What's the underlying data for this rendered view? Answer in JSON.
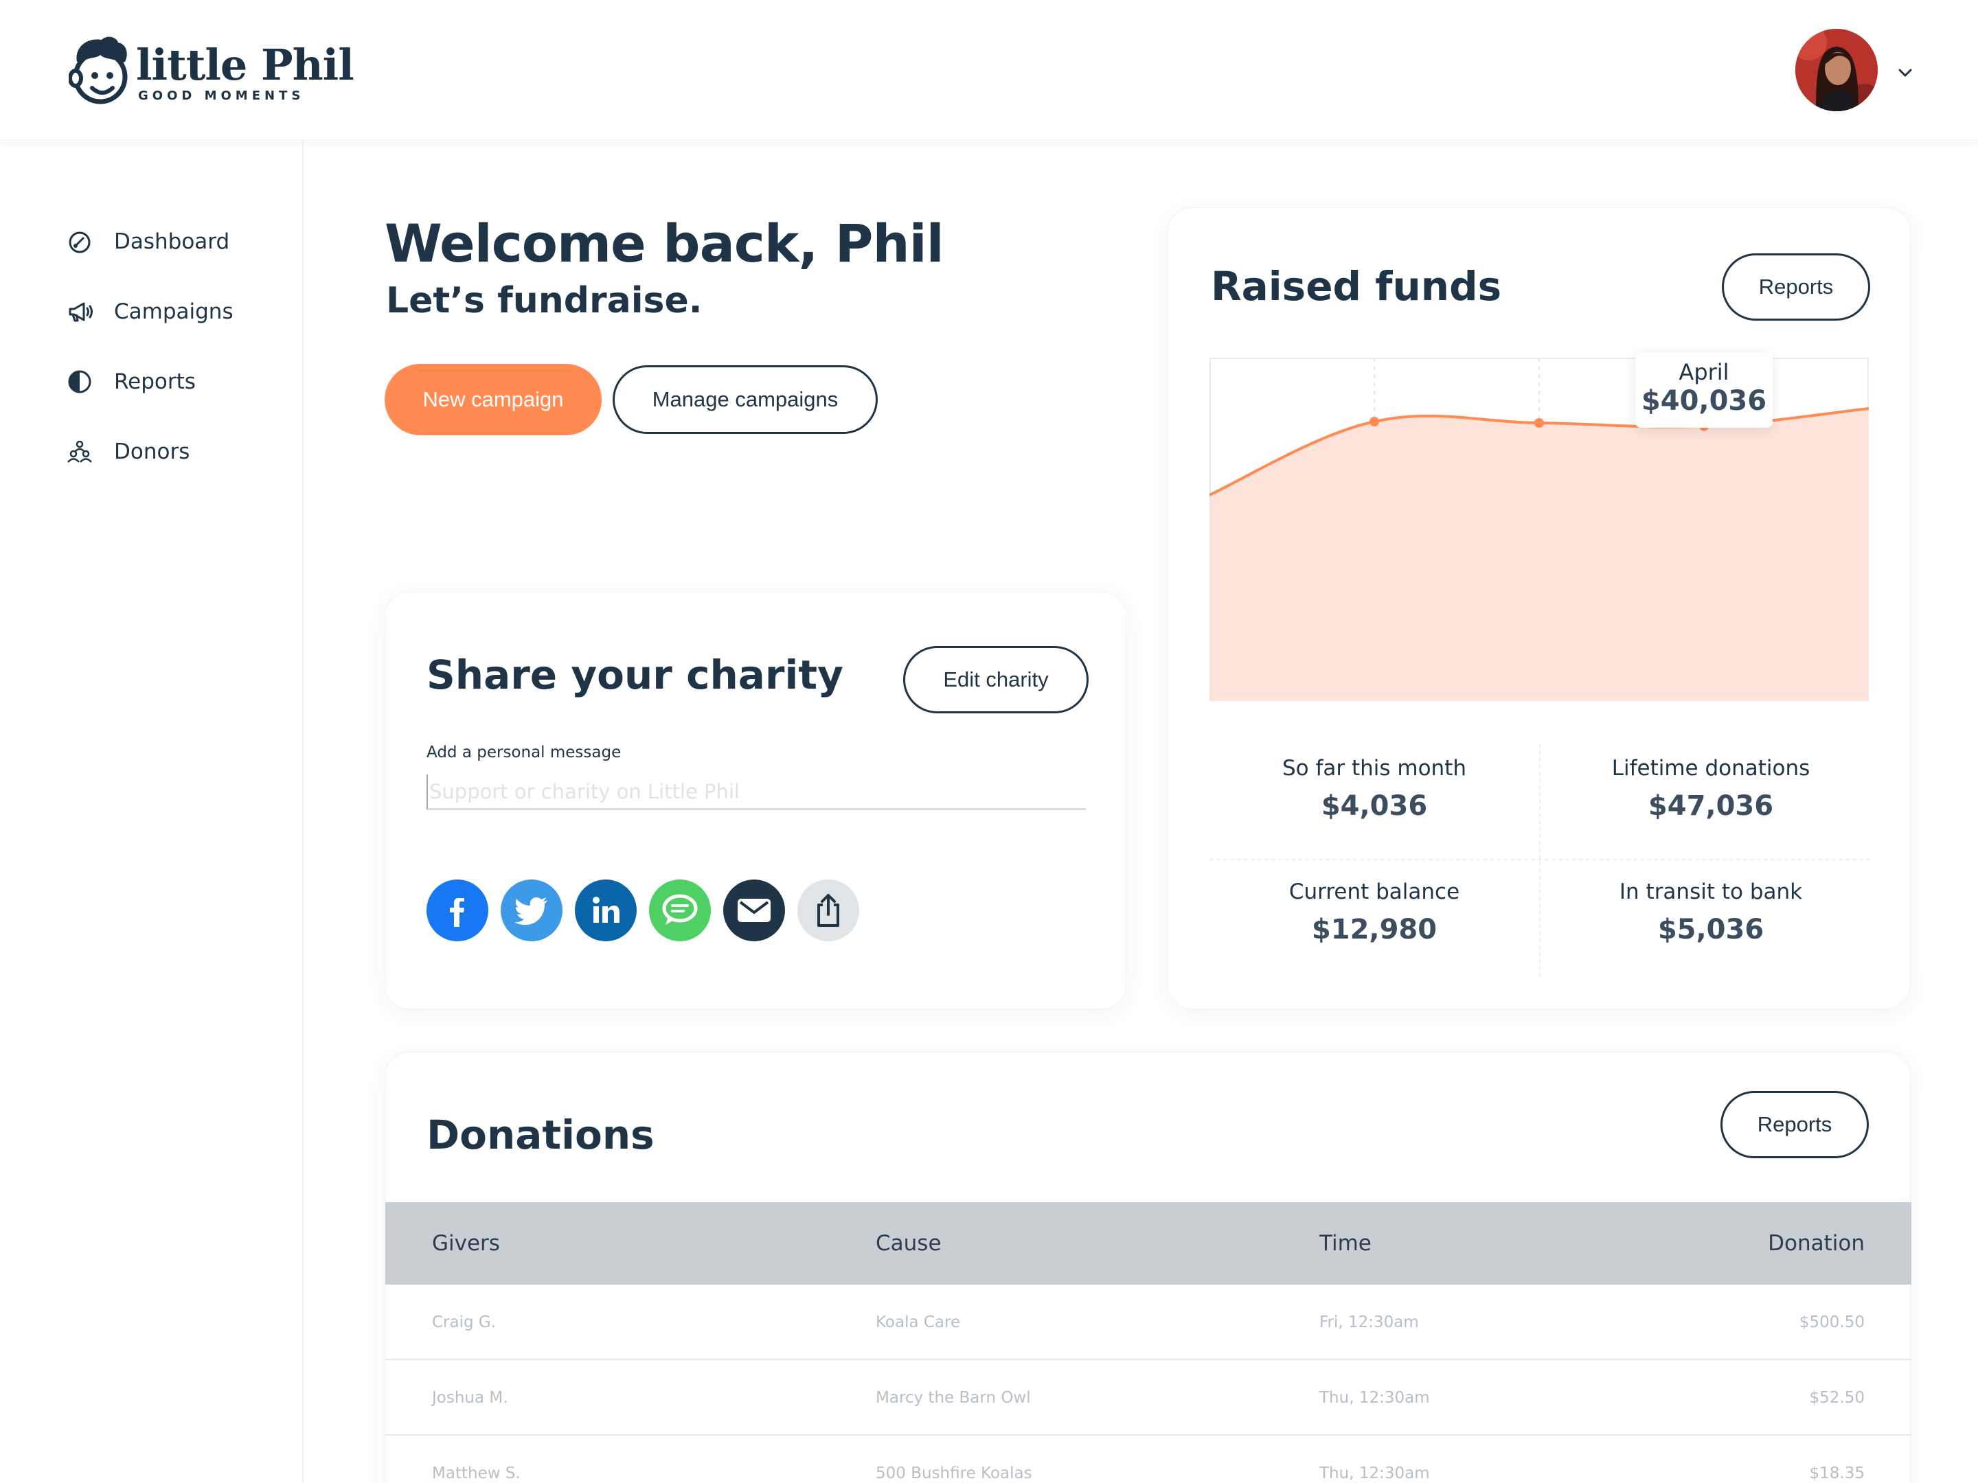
{
  "brand": {
    "name": "little Phil",
    "tagline": "GOOD MOMENTS"
  },
  "colors": {
    "accent": "#ff8a52",
    "navy": "#1f3447",
    "chart_fill": "#fde3d9",
    "table_header": "#c9ced3"
  },
  "sidebar": {
    "items": [
      {
        "label": "Dashboard",
        "icon": "gauge-icon"
      },
      {
        "label": "Campaigns",
        "icon": "megaphone-icon"
      },
      {
        "label": "Reports",
        "icon": "pie-chart-icon"
      },
      {
        "label": "Donors",
        "icon": "people-icon"
      }
    ]
  },
  "welcome": {
    "title": "Welcome back, Phil",
    "subtitle": "Let’s fundraise.",
    "new_campaign_label": "New campaign",
    "manage_campaigns_label": "Manage campaigns"
  },
  "share": {
    "title": "Share your charity",
    "edit_label": "Edit charity",
    "message_label": "Add a personal message",
    "message_placeholder": "Support or charity on Little Phil",
    "message_value": "",
    "networks": [
      "facebook-icon",
      "twitter-icon",
      "linkedin-icon",
      "message-icon",
      "email-icon",
      "share-icon"
    ]
  },
  "funds": {
    "title": "Raised funds",
    "reports_label": "Reports",
    "tooltip": {
      "month": "April",
      "value": "$40,036"
    },
    "stats": [
      {
        "label": "So far this month",
        "value": "$4,036"
      },
      {
        "label": "Lifetime donations",
        "value": "$47,036"
      },
      {
        "label": "Current balance",
        "value": "$12,980"
      },
      {
        "label": "In transit to bank",
        "value": "$5,036"
      }
    ]
  },
  "chart_data": {
    "type": "area",
    "points": [
      {
        "value": 30000
      },
      {
        "value": 40700
      },
      {
        "value": 40500
      },
      {
        "value": 40036
      },
      {
        "value": 42600
      }
    ],
    "highlighted_index": 3,
    "ylim": [
      0,
      50000
    ],
    "grid": true,
    "legend": "none"
  },
  "donations": {
    "title": "Donations",
    "reports_label": "Reports",
    "columns": [
      "Givers",
      "Cause",
      "Time",
      "Donation"
    ],
    "rows": [
      [
        "Craig G.",
        "Koala Care",
        "Fri, 12:30am",
        "$500.50"
      ],
      [
        "Joshua M.",
        "Marcy the Barn Owl",
        "Thu, 12:30am",
        "$52.50"
      ],
      [
        "Matthew S.",
        "500 Bushfire Koalas",
        "Thu, 12:30am",
        "$18.35"
      ]
    ]
  }
}
